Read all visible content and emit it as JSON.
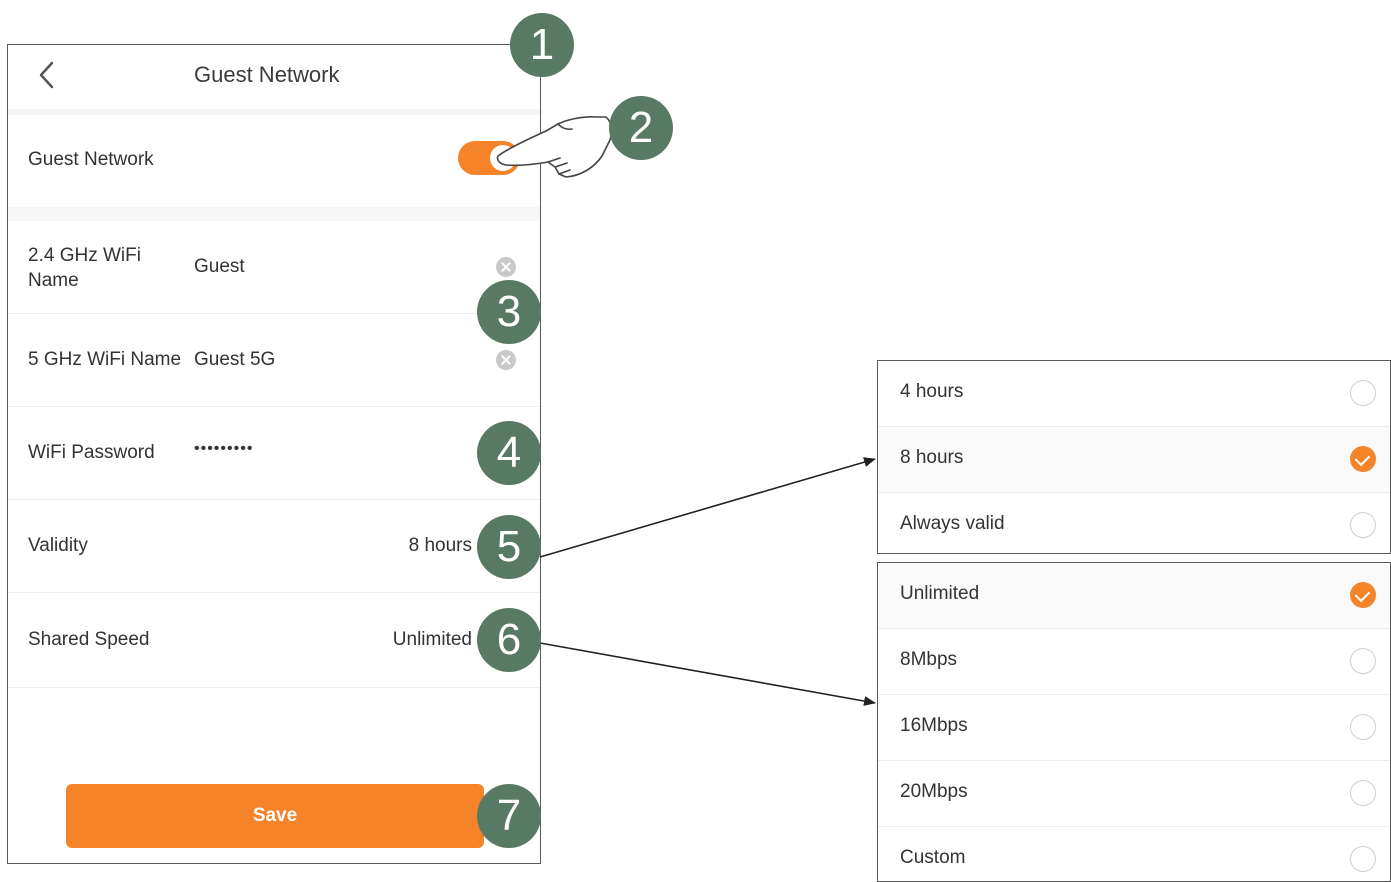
{
  "screen": {
    "title": "Guest Network",
    "back_icon": "chevron-left-icon",
    "guest_network": {
      "label": "Guest Network",
      "enabled": true
    },
    "wifi_24": {
      "label_line1": "2.4 GHz WiFi",
      "label_line2": "Name",
      "value": "Guest"
    },
    "wifi_5": {
      "label": "5 GHz WiFi Name",
      "value": "Guest 5G"
    },
    "wifi_password": {
      "label": "WiFi Password",
      "value": "•••••••••"
    },
    "validity": {
      "label": "Validity",
      "value": "8 hours"
    },
    "shared_speed": {
      "label": "Shared Speed",
      "value": "Unlimited"
    },
    "save_label": "Save"
  },
  "callouts": [
    "1",
    "2",
    "3",
    "4",
    "5",
    "6",
    "7"
  ],
  "validity_options": [
    {
      "label": "4 hours",
      "selected": false
    },
    {
      "label": "8 hours",
      "selected": true
    },
    {
      "label": "Always valid",
      "selected": false
    }
  ],
  "speed_options": [
    {
      "label": "Unlimited",
      "selected": true
    },
    {
      "label": "8Mbps",
      "selected": false
    },
    {
      "label": "16Mbps",
      "selected": false
    },
    {
      "label": "20Mbps",
      "selected": false
    },
    {
      "label": "Custom",
      "selected": false
    }
  ],
  "colors": {
    "accent": "#f5832a",
    "callout": "#587a64",
    "radio_border": "#cfcfcf"
  }
}
